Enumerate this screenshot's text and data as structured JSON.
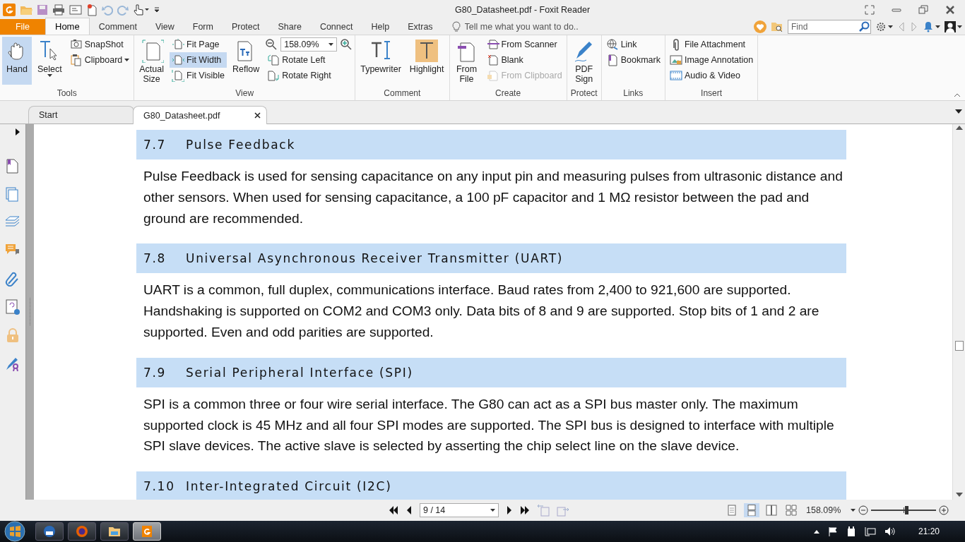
{
  "window": {
    "title": "G80_Datasheet.pdf - Foxit Reader"
  },
  "file_button": "File",
  "menu_tabs": [
    {
      "label": "Home",
      "selected": true
    },
    {
      "label": "Comment",
      "selected": false
    },
    {
      "label": "View",
      "selected": false
    },
    {
      "label": "Form",
      "selected": false
    },
    {
      "label": "Protect",
      "selected": false
    },
    {
      "label": "Share",
      "selected": false
    },
    {
      "label": "Connect",
      "selected": false
    },
    {
      "label": "Help",
      "selected": false
    },
    {
      "label": "Extras",
      "selected": false
    }
  ],
  "tell_me": {
    "placeholder": "Tell me what you want to do.."
  },
  "find": {
    "placeholder": "Find"
  },
  "ribbon_groups": [
    {
      "label": "Tools",
      "columns": [
        {
          "kind": "large",
          "label": "Hand",
          "selected": true,
          "menu": false
        },
        {
          "kind": "large",
          "label": "Select",
          "selected": false,
          "menu": true
        },
        {
          "kind": "stack",
          "items": [
            {
              "kind": "small",
              "label": "SnapShot",
              "selected": false,
              "disabled": false,
              "menu": false
            },
            {
              "kind": "small",
              "label": "Clipboard",
              "selected": false,
              "disabled": false,
              "menu": true
            }
          ]
        }
      ]
    },
    {
      "label": "View",
      "columns": [
        {
          "kind": "large",
          "label": "Actual Size",
          "selected": false,
          "menu": false
        },
        {
          "kind": "stack",
          "items": [
            {
              "kind": "small",
              "label": "Fit Page",
              "selected": false,
              "disabled": false,
              "menu": false
            },
            {
              "kind": "small",
              "label": "Fit Width",
              "selected": true,
              "disabled": false,
              "menu": false
            },
            {
              "kind": "small",
              "label": "Fit Visible",
              "selected": false,
              "disabled": false,
              "menu": false
            }
          ]
        },
        {
          "kind": "large",
          "label": "Reflow",
          "selected": false,
          "menu": false
        },
        {
          "kind": "stack",
          "items": [
            {
              "kind": "zoom",
              "value": "158.09%"
            },
            {
              "kind": "small",
              "label": "Rotate Left",
              "selected": false,
              "disabled": false,
              "menu": false
            },
            {
              "kind": "small",
              "label": "Rotate Right",
              "selected": false,
              "disabled": false,
              "menu": false
            }
          ]
        }
      ]
    },
    {
      "label": "Comment",
      "columns": [
        {
          "kind": "large",
          "label": "Typewriter",
          "selected": false,
          "menu": false
        },
        {
          "kind": "large",
          "label": "Highlight",
          "selected": false,
          "menu": false
        }
      ]
    },
    {
      "label": "Create",
      "columns": [
        {
          "kind": "large",
          "label": "From File",
          "selected": false,
          "menu": false
        },
        {
          "kind": "stack",
          "items": [
            {
              "kind": "small",
              "label": "From Scanner",
              "selected": false,
              "disabled": false,
              "menu": false
            },
            {
              "kind": "small",
              "label": "Blank",
              "selected": false,
              "disabled": false,
              "menu": false
            },
            {
              "kind": "small",
              "label": "From Clipboard",
              "selected": false,
              "disabled": true,
              "menu": false
            }
          ]
        }
      ]
    },
    {
      "label": "Protect",
      "columns": [
        {
          "kind": "large",
          "label": "PDF Sign",
          "selected": false,
          "menu": false
        }
      ]
    },
    {
      "label": "Links",
      "columns": [
        {
          "kind": "stack",
          "items": [
            {
              "kind": "small",
              "label": "Link",
              "selected": false,
              "disabled": false,
              "menu": false
            },
            {
              "kind": "small",
              "label": "Bookmark",
              "selected": false,
              "disabled": false,
              "menu": false
            }
          ]
        }
      ]
    },
    {
      "label": "Insert",
      "columns": [
        {
          "kind": "stack",
          "items": [
            {
              "kind": "small",
              "label": "File Attachment",
              "selected": false,
              "disabled": false,
              "menu": false
            },
            {
              "kind": "small",
              "label": "Image Annotation",
              "selected": false,
              "disabled": false,
              "menu": false
            },
            {
              "kind": "small",
              "label": "Audio & Video",
              "selected": false,
              "disabled": false,
              "menu": false
            }
          ]
        }
      ]
    }
  ],
  "doc_tabs": [
    {
      "label": "Start",
      "selected": false,
      "closable": false
    },
    {
      "label": "G80_Datasheet.pdf",
      "selected": true,
      "closable": true
    }
  ],
  "document": {
    "sections": [
      {
        "number": "7.7",
        "title": "Pulse Feedback",
        "body": "Pulse Feedback is used for sensing capacitance on any input pin and measuring pulses from ultrasonic distance and other sensors. When used for sensing capacitance, a 100 pF capacitor and 1 MΩ resistor between the pad and ground are recommended."
      },
      {
        "number": "7.8",
        "title": "Universal Asynchronous Receiver Transmitter (UART)",
        "body": "UART is a common, full duplex, communications interface. Baud rates from 2,400 to 921,600 are supported. Handshaking is supported on COM2 and COM3 only. Data bits of 8 and 9 are supported. Stop bits of 1 and 2 are supported. Even and odd parities are supported."
      },
      {
        "number": "7.9",
        "title": "Serial Peripheral Interface (SPI)",
        "body": "SPI is a common three or four wire serial interface. The G80 can act as a SPI bus master only. The maximum supported clock is 45 MHz and all four SPI modes are supported. The SPI bus is designed to interface with multiple SPI slave devices. The active slave is selected by asserting the chip select line on the slave device."
      },
      {
        "number": "7.10",
        "title": "Inter-Integrated Circuit (I2C)"
      }
    ]
  },
  "status_bar": {
    "page": "9 / 14",
    "view_modes": [
      {
        "selected": false
      },
      {
        "selected": true
      },
      {
        "selected": false
      },
      {
        "selected": false
      }
    ],
    "zoom": "158.09%",
    "zoom_slider": {
      "level": 0.54
    }
  },
  "taskbar": {
    "apps": [
      {
        "selected": false
      },
      {
        "selected": false
      },
      {
        "selected": false
      },
      {
        "selected": true
      }
    ],
    "clock": "21:20"
  }
}
